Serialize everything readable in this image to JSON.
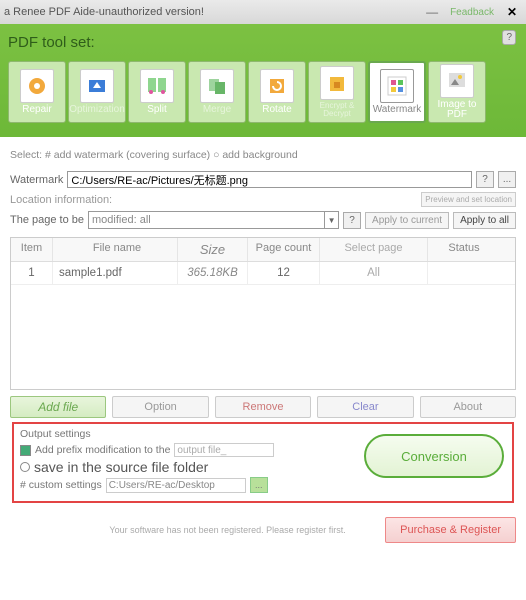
{
  "titlebar": {
    "text": "a Renee PDF Aide-unauthorized version!",
    "feedback": "Feadback"
  },
  "panel": {
    "title": "PDF tool set:"
  },
  "tools": [
    {
      "name": "repair",
      "label": "Repair"
    },
    {
      "name": "optimization",
      "label": "Optimization"
    },
    {
      "name": "split",
      "label": "Split"
    },
    {
      "name": "merge",
      "label": "Merge"
    },
    {
      "name": "rotate",
      "label": "Rotate"
    },
    {
      "name": "encrypt",
      "label": "Encrypt & Decrypt"
    },
    {
      "name": "watermark",
      "label": "Watermark"
    },
    {
      "name": "imgpdf",
      "label": "Image to PDF"
    }
  ],
  "select_row": "Select: # add watermark (covering surface) ○ add background",
  "watermark": {
    "label": "Watermark",
    "value": "C:/Users/RE-ac/Pictures/无标题.png",
    "help": "?",
    "browse": "..."
  },
  "location": {
    "label": "Location information:",
    "preview": "Preview and set location"
  },
  "pagemod": {
    "label": "The page to be",
    "value": "modified: all",
    "help": "?",
    "apply_current": "Apply to current",
    "apply_all": "Apply to all"
  },
  "table": {
    "headers": {
      "item": "Item",
      "file": "File name",
      "size": "Size",
      "page": "Page count",
      "select": "Select page",
      "status": "Status"
    },
    "rows": [
      {
        "item": "1",
        "file": "sample1.pdf",
        "size": "365.18KB",
        "page": "12",
        "select": "All",
        "status": ""
      }
    ]
  },
  "buttons": {
    "add": "Add file",
    "option": "Option",
    "remove": "Remove",
    "clear": "Clear",
    "about": "About"
  },
  "output": {
    "title": "Output settings",
    "prefix_label": "Add prefix modification to the",
    "prefix_value": "output file_",
    "save_folder": "save in the source file folder",
    "custom_label": "# custom settings",
    "custom_value": "C:Users/RE-ac/Desktop",
    "browse": "...",
    "conversion": "Conversion"
  },
  "footer": {
    "text": "Your software has not been registered. Please register first.",
    "purchase": "Purchase & Register"
  }
}
